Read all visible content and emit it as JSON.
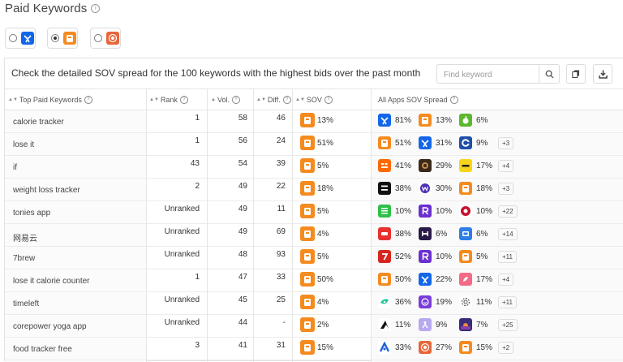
{
  "page": {
    "title": "Paid Keywords",
    "info_icon": "i"
  },
  "app_selector": [
    {
      "icon": "myfitnesspal",
      "color": "#1366e8",
      "selected": false
    },
    {
      "icon": "loseit",
      "color": "#f58b1f",
      "selected": true
    },
    {
      "icon": "target-app",
      "color": "#e8663a",
      "selected": false
    }
  ],
  "panel": {
    "description": "Check the detailed SOV spread for the 100 keywords with the highest bids over the past month",
    "search_placeholder": "Find keyword"
  },
  "columns": {
    "keyword": "Top Paid Keywords",
    "rank": "Rank",
    "volume": "Vol.",
    "difficulty": "Diff.",
    "sov": "SOV",
    "spread": "All Apps SOV Spread"
  },
  "rows": [
    {
      "keyword": "calorie tracker",
      "rank": "1",
      "vol": "58",
      "diff": "46",
      "sov": "13%",
      "spread": [
        {
          "app": "myfitnesspal",
          "pct": "81%"
        },
        {
          "app": "loseit",
          "pct": "13%"
        },
        {
          "app": "green-app",
          "pct": "6%"
        }
      ],
      "more": ""
    },
    {
      "keyword": "lose it",
      "rank": "1",
      "vol": "56",
      "diff": "24",
      "sov": "51%",
      "spread": [
        {
          "app": "loseit",
          "pct": "51%"
        },
        {
          "app": "myfitnesspal",
          "pct": "31%"
        },
        {
          "app": "cronometer",
          "pct": "9%"
        }
      ],
      "more": "+3"
    },
    {
      "keyword": "if",
      "rank": "43",
      "vol": "54",
      "diff": "39",
      "sov": "5%",
      "spread": [
        {
          "app": "orange-text",
          "pct": "41%"
        },
        {
          "app": "brown-app",
          "pct": "29%"
        },
        {
          "app": "yellow-app",
          "pct": "17%"
        }
      ],
      "more": "+4"
    },
    {
      "keyword": "weight loss tracker",
      "rank": "2",
      "vol": "49",
      "diff": "22",
      "sov": "18%",
      "spread": [
        {
          "app": "drcal",
          "pct": "38%"
        },
        {
          "app": "purple-w",
          "pct": "30%"
        },
        {
          "app": "loseit",
          "pct": "18%"
        }
      ],
      "more": "+3"
    },
    {
      "keyword": "tonies app",
      "rank": "Unranked",
      "vol": "49",
      "diff": "11",
      "sov": "5%",
      "spread": [
        {
          "app": "green-stripe",
          "pct": "10%"
        },
        {
          "app": "purple-r",
          "pct": "10%"
        },
        {
          "app": "red-circle",
          "pct": "10%"
        }
      ],
      "more": "+22"
    },
    {
      "keyword": "网易云",
      "rank": "Unranked",
      "vol": "49",
      "diff": "69",
      "sov": "4%",
      "spread": [
        {
          "app": "red-badge",
          "pct": "38%"
        },
        {
          "app": "purple-bed",
          "pct": "6%"
        },
        {
          "app": "blue-app",
          "pct": "6%"
        }
      ],
      "more": "+14"
    },
    {
      "keyword": "7brew",
      "rank": "Unranked",
      "vol": "48",
      "diff": "93",
      "sov": "5%",
      "spread": [
        {
          "app": "red-7",
          "pct": "52%"
        },
        {
          "app": "purple-r",
          "pct": "10%"
        },
        {
          "app": "loseit",
          "pct": "5%"
        }
      ],
      "more": "+11"
    },
    {
      "keyword": "lose it calorie counter",
      "rank": "1",
      "vol": "47",
      "diff": "33",
      "sov": "50%",
      "spread": [
        {
          "app": "loseit",
          "pct": "50%"
        },
        {
          "app": "myfitnesspal",
          "pct": "22%"
        },
        {
          "app": "pink-app",
          "pct": "17%"
        }
      ],
      "more": "+4"
    },
    {
      "keyword": "timeleft",
      "rank": "Unranked",
      "vol": "45",
      "diff": "25",
      "sov": "4%",
      "spread": [
        {
          "app": "teal-app",
          "pct": "36%"
        },
        {
          "app": "purple-smile",
          "pct": "19%"
        },
        {
          "app": "gear-app",
          "pct": "11%"
        }
      ],
      "more": "+11"
    },
    {
      "keyword": "corepower yoga app",
      "rank": "Unranked",
      "vol": "44",
      "diff": "-",
      "sov": "2%",
      "spread": [
        {
          "app": "black-tri",
          "pct": "11%"
        },
        {
          "app": "lavender-app",
          "pct": "9%"
        },
        {
          "app": "sunset-app",
          "pct": "7%"
        }
      ],
      "more": "+25"
    },
    {
      "keyword": "food tracker free",
      "rank": "3",
      "vol": "41",
      "diff": "31",
      "sov": "15%",
      "spread": [
        {
          "app": "blue-a",
          "pct": "33%"
        },
        {
          "app": "target-app",
          "pct": "27%"
        },
        {
          "app": "loseit",
          "pct": "15%"
        }
      ],
      "more": "+2"
    }
  ]
}
